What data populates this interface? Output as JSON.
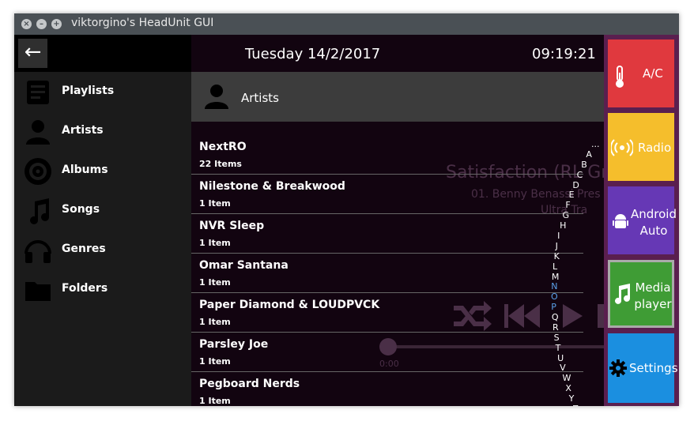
{
  "window": {
    "title": "viktorgino's HeadUnit GUI"
  },
  "header": {
    "date": "Tuesday 14/2/2017",
    "time": "09:19:21"
  },
  "sidebar": {
    "items": [
      {
        "label": "Playlists",
        "icon": "playlist-icon"
      },
      {
        "label": "Artists",
        "icon": "person-icon"
      },
      {
        "label": "Albums",
        "icon": "disc-icon"
      },
      {
        "label": "Songs",
        "icon": "music-note-icon"
      },
      {
        "label": "Genres",
        "icon": "headphones-icon"
      },
      {
        "label": "Folders",
        "icon": "folder-icon"
      }
    ]
  },
  "browser": {
    "title": "Artists",
    "rows": [
      {
        "name": "NextRO",
        "count": "22 Items"
      },
      {
        "name": "Nilestone & Breakwood",
        "count": "1 Item"
      },
      {
        "name": "NVR Sleep",
        "count": "1 Item"
      },
      {
        "name": "Omar Santana",
        "count": "1 Item"
      },
      {
        "name": "Paper Diamond & LOUDPVCK",
        "count": "1 Item"
      },
      {
        "name": "Parsley Joe",
        "count": "1 Item"
      },
      {
        "name": "Pegboard Nerds",
        "count": "1 Item"
      }
    ],
    "alphabet": [
      "...",
      "A",
      "B",
      "C",
      "D",
      "E",
      "F",
      "G",
      "H",
      "I",
      "J",
      "K",
      "L",
      "M",
      "N",
      "O",
      "P",
      "Q",
      "R",
      "S",
      "T",
      "U",
      "V",
      "W",
      "X",
      "Y",
      "Z"
    ],
    "active_letters": [
      "N",
      "O",
      "P"
    ]
  },
  "now_playing": {
    "title": "Satisfaction (RL Gr",
    "subtitle": "01. Benny Benassi Pres",
    "album": "Ultra Tra",
    "elapsed": "0:00"
  },
  "tiles": [
    {
      "label": "A/C",
      "icon": "thermometer-icon",
      "color": "#e0393e"
    },
    {
      "label": "Radio",
      "icon": "radio-icon",
      "color": "#f5be2c"
    },
    {
      "label": "Android Auto",
      "icon": "android-icon",
      "color": "#6638b5"
    },
    {
      "label": "Media player",
      "icon": "music-note-icon",
      "color": "#3f9c35"
    },
    {
      "label": "Settings",
      "icon": "gear-icon",
      "color": "#1b8fe0"
    }
  ],
  "colors": {
    "accent_letter": "#5aa0e8",
    "tile_border_active": "#aaaaaa"
  }
}
